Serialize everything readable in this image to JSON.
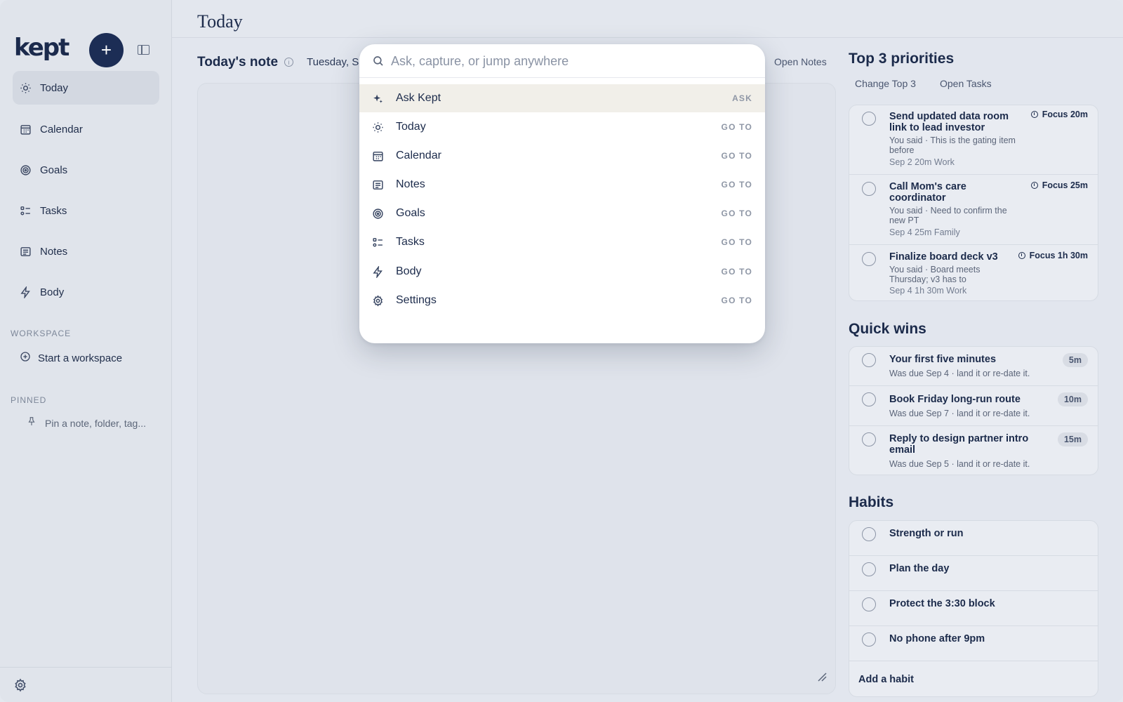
{
  "app": {
    "logo": "kept",
    "new_label": "+"
  },
  "sidebar": {
    "items": [
      {
        "label": "Today",
        "icon": "sun-icon",
        "active": true
      },
      {
        "label": "Calendar",
        "icon": "calendar-icon"
      },
      {
        "label": "Goals",
        "icon": "target-icon"
      },
      {
        "label": "Tasks",
        "icon": "tasks-icon"
      },
      {
        "label": "Notes",
        "icon": "notes-icon"
      },
      {
        "label": "Body",
        "icon": "bolt-icon"
      }
    ],
    "workspace_label": "WORKSPACE",
    "workspace_action": "Start a workspace",
    "pinned_label": "PINNED",
    "pinned_placeholder": "Pin a note, folder, tag..."
  },
  "header": {
    "title": "Today"
  },
  "note": {
    "title": "Today's note",
    "date": "Tuesday, S",
    "open_notes": "Open Notes"
  },
  "priorities": {
    "title": "Top 3 priorities",
    "change_label": "Change Top 3",
    "open_tasks_label": "Open Tasks",
    "items": [
      {
        "title": "Send updated data room link to lead investor",
        "sub": "You said · This is the gating item before",
        "meta": "Sep 2  20m  Work",
        "focus": "Focus 20m"
      },
      {
        "title": "Call Mom's care coordinator",
        "sub": "You said · Need to confirm the new PT",
        "meta": "Sep 4  25m  Family",
        "focus": "Focus 25m"
      },
      {
        "title": "Finalize board deck v3",
        "sub": "You said · Board meets Thursday; v3 has to",
        "meta": "Sep 4  1h 30m  Work",
        "focus": "Focus 1h 30m"
      }
    ]
  },
  "quick_wins": {
    "title": "Quick wins",
    "items": [
      {
        "title": "Your first five minutes",
        "sub": "Was due Sep 4 · land it or re-date it.",
        "pill": "5m"
      },
      {
        "title": "Book Friday long-run route",
        "sub": "Was due Sep 7 · land it or re-date it.",
        "pill": "10m"
      },
      {
        "title": "Reply to design partner intro email",
        "sub": "Was due Sep 5 · land it or re-date it.",
        "pill": "15m"
      }
    ]
  },
  "habits": {
    "title": "Habits",
    "items": [
      "Strength or run",
      "Plan the day",
      "Protect the 3:30 block",
      "No phone after 9pm"
    ],
    "add_label": "Add a habit"
  },
  "palette": {
    "placeholder": "Ask, capture, or jump anywhere",
    "items": [
      {
        "label": "Ask Kept",
        "hint": "ASK",
        "icon": "sparkle-icon",
        "selected": true
      },
      {
        "label": "Today",
        "hint": "GO TO",
        "icon": "sun-icon"
      },
      {
        "label": "Calendar",
        "hint": "GO TO",
        "icon": "calendar-icon"
      },
      {
        "label": "Notes",
        "hint": "GO TO",
        "icon": "notes-icon"
      },
      {
        "label": "Goals",
        "hint": "GO TO",
        "icon": "target-icon"
      },
      {
        "label": "Tasks",
        "hint": "GO TO",
        "icon": "tasks-icon"
      },
      {
        "label": "Body",
        "hint": "GO TO",
        "icon": "bolt-icon"
      },
      {
        "label": "Settings",
        "hint": "GO TO",
        "icon": "gear-icon"
      }
    ]
  },
  "colors": {
    "accent": "#1c2d55",
    "selected_row": "#f1efe9"
  }
}
